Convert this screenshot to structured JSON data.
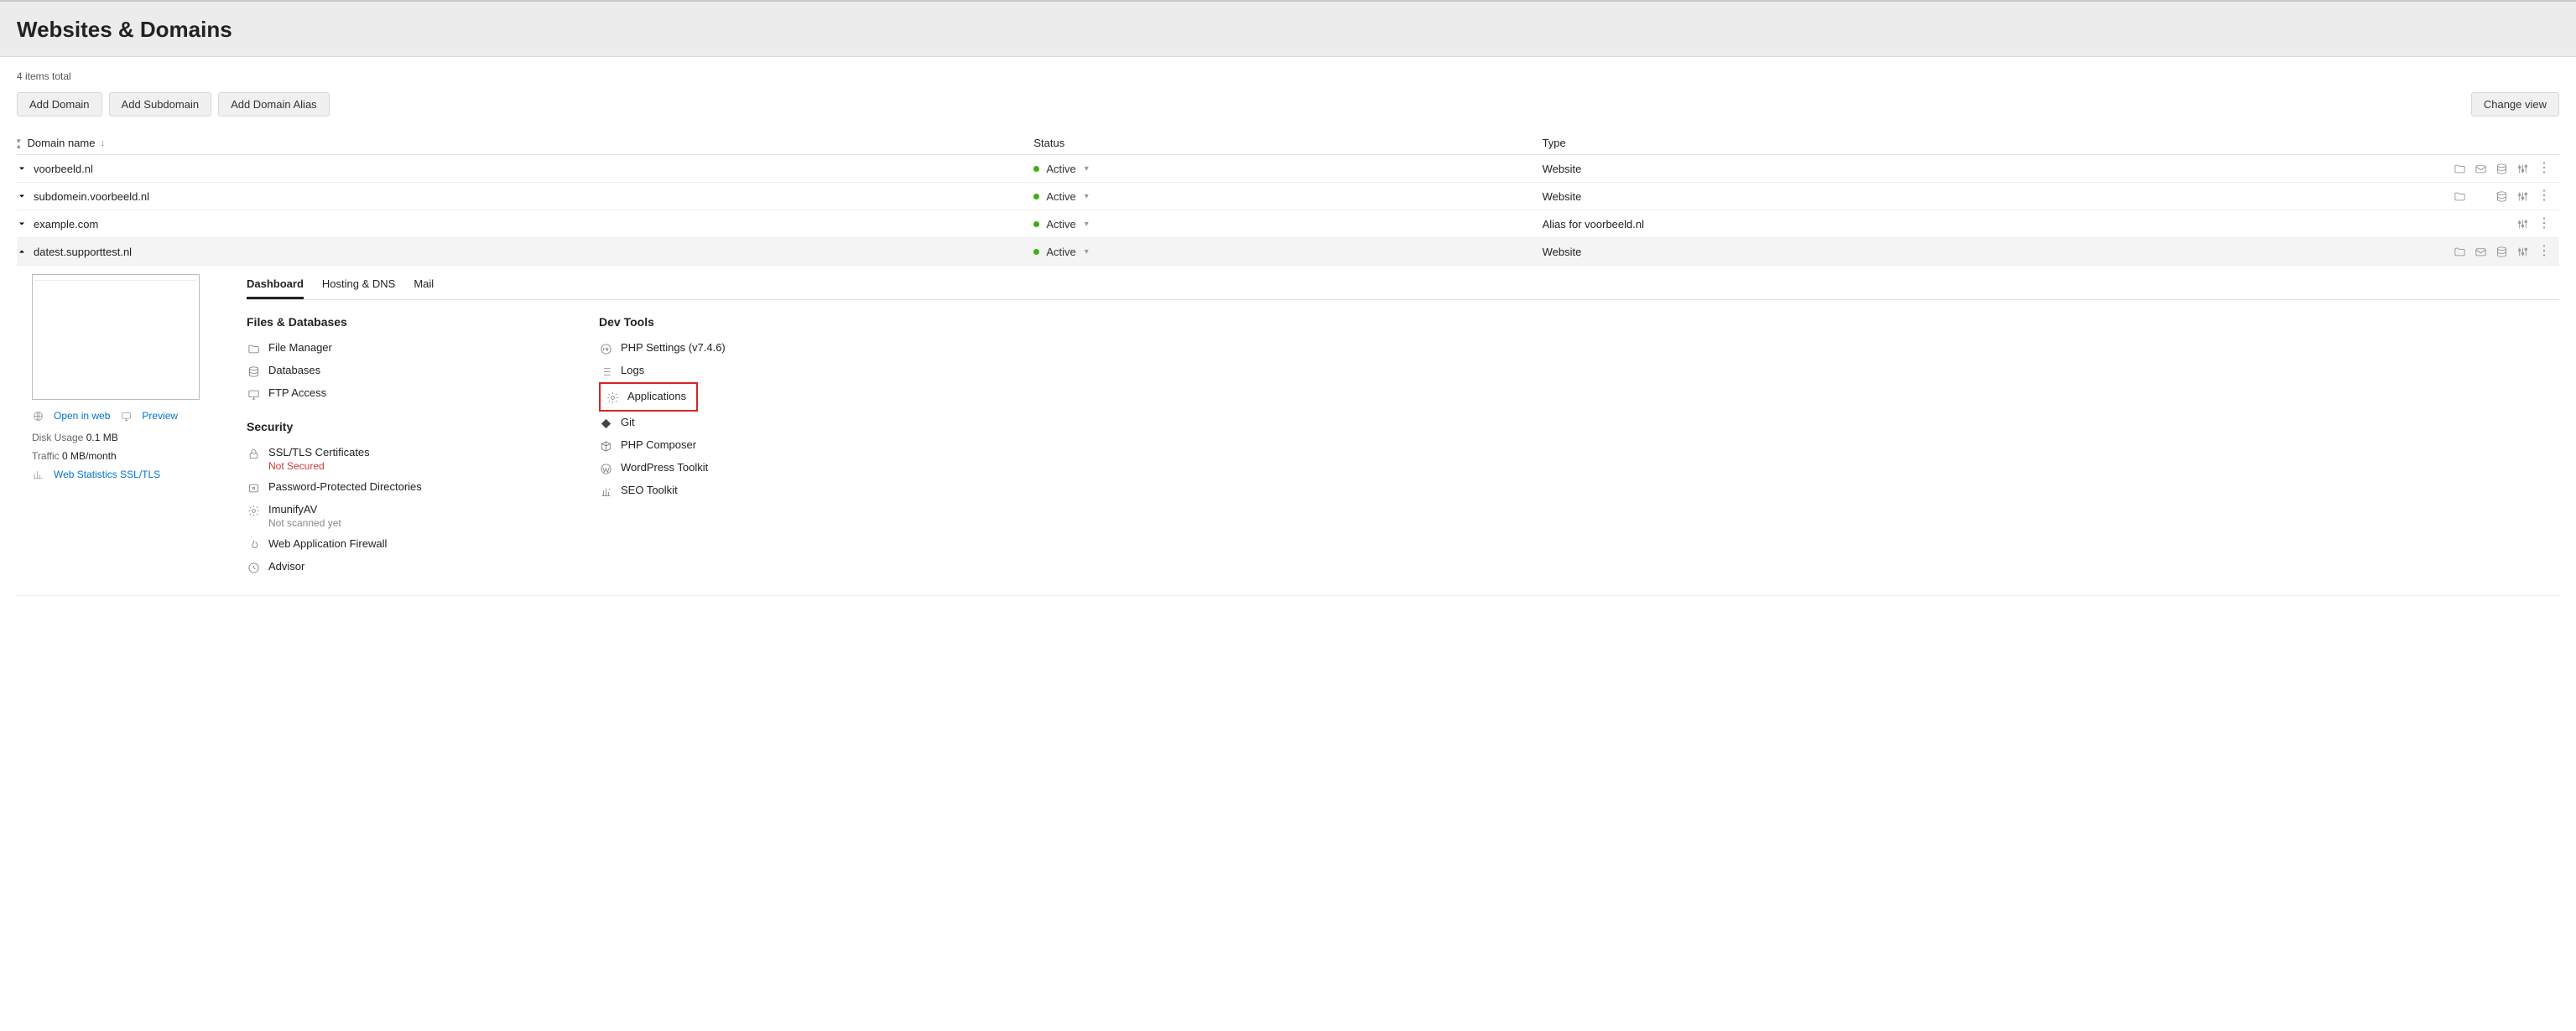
{
  "header": {
    "title": "Websites & Domains"
  },
  "items_total": "4 items total",
  "actions": {
    "add_domain": "Add Domain",
    "add_subdomain": "Add Subdomain",
    "add_alias": "Add Domain Alias",
    "change_view": "Change view"
  },
  "columns": {
    "domain": "Domain name",
    "status": "Status",
    "type": "Type"
  },
  "sort_indicator": "↓",
  "rows": [
    {
      "name": "voorbeeld.nl",
      "status": "Active",
      "type": "Website",
      "actions": [
        "folder",
        "mail",
        "db",
        "sliders",
        "kebab"
      ],
      "expanded": false
    },
    {
      "name": "subdomein.voorbeeld.nl",
      "status": "Active",
      "type": "Website",
      "actions": [
        "folder",
        "db",
        "sliders",
        "kebab"
      ],
      "expanded": false
    },
    {
      "name": "example.com",
      "status": "Active",
      "type": "Alias for voorbeeld.nl",
      "actions": [
        "sliders",
        "kebab"
      ],
      "expanded": false
    },
    {
      "name": "datest.supporttest.nl",
      "status": "Active",
      "type": "Website",
      "actions": [
        "folder",
        "mail",
        "db",
        "sliders",
        "kebab"
      ],
      "expanded": true
    }
  ],
  "detail": {
    "tabs": {
      "dashboard": "Dashboard",
      "hosting": "Hosting & DNS",
      "mail": "Mail"
    },
    "side": {
      "open_in_web": "Open in web",
      "preview": "Preview",
      "disk_label": "Disk Usage",
      "disk_value": "0.1 MB",
      "traffic_label": "Traffic",
      "traffic_value": "0 MB/month",
      "web_stats": "Web Statistics SSL/TLS"
    },
    "files_section": "Files & Databases",
    "files_items": {
      "file_manager": "File Manager",
      "databases": "Databases",
      "ftp": "FTP Access"
    },
    "security_section": "Security",
    "security_items": {
      "ssl": "SSL/TLS Certificates",
      "ssl_sub": "Not Secured",
      "pwd_dirs": "Password-Protected Directories",
      "imunify": "ImunifyAV",
      "imunify_sub": "Not scanned yet",
      "waf": "Web Application Firewall",
      "advisor": "Advisor"
    },
    "dev_section": "Dev Tools",
    "dev_items": {
      "php": "PHP Settings (v7.4.6)",
      "logs": "Logs",
      "applications": "Applications",
      "git": "Git",
      "composer": "PHP Composer",
      "wp": "WordPress Toolkit",
      "seo": "SEO Toolkit"
    }
  }
}
